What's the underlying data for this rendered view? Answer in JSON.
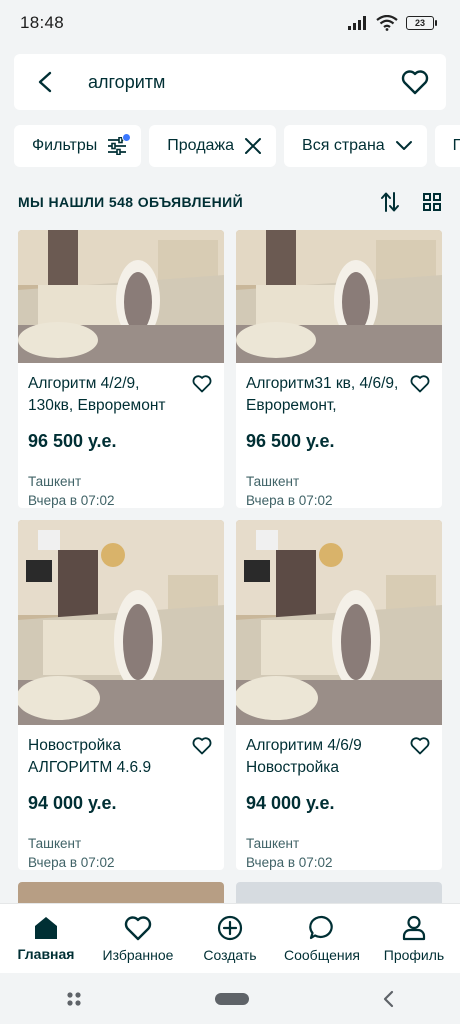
{
  "status": {
    "time": "18:48",
    "battery": "23"
  },
  "search": {
    "query": "алгоритм"
  },
  "filters": [
    {
      "label": "Фильтры",
      "icon": "sliders-icon"
    },
    {
      "label": "Продажа",
      "icon": "close-icon"
    },
    {
      "label": "Вся страна",
      "icon": "chevron-down-icon"
    },
    {
      "label": "П",
      "icon": ""
    }
  ],
  "results": {
    "count_label": "МЫ НАШЛИ 548 ОБЪЯВЛЕНИЙ"
  },
  "listings": [
    {
      "title": "Алгоритм 4/2/9, 130кв, Евроремонт",
      "price": "96 500 у.е.",
      "location": "Ташкент",
      "date": "Вчера в 07:02"
    },
    {
      "title": "Алгоритм31 кв, 4/6/9, Евроремонт,",
      "price": "96 500 у.е.",
      "location": "Ташкент",
      "date": "Вчера в 07:02"
    },
    {
      "title": "Новостройка АЛГОРИТМ 4.6.9",
      "price": "94 000 у.е.",
      "location": "Ташкент",
      "date": "Вчера в 07:02"
    },
    {
      "title": "Алгоритим 4/6/9 Новостройка",
      "price": "94 000 у.е.",
      "location": "Ташкент",
      "date": "Вчера в 07:02"
    }
  ],
  "nav": [
    {
      "label": "Главная",
      "icon": "home-icon",
      "active": true
    },
    {
      "label": "Избранное",
      "icon": "heart-icon"
    },
    {
      "label": "Создать",
      "icon": "plus-circle-icon"
    },
    {
      "label": "Сообщения",
      "icon": "chat-icon"
    },
    {
      "label": "Профиль",
      "icon": "user-icon"
    }
  ],
  "colors": {
    "primary": "#002f34",
    "accent_dot": "#3a77ff",
    "background": "#f2f4f5"
  }
}
